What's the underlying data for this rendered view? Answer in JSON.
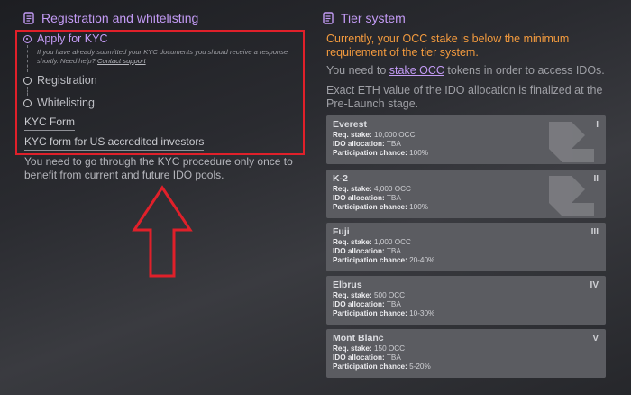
{
  "left_panel": {
    "title": "Registration and whitelisting",
    "steps": [
      {
        "label": "Apply for KYC",
        "active": true
      },
      {
        "label": "Registration",
        "active": false
      },
      {
        "label": "Whitelisting",
        "active": false
      }
    ],
    "kyc_note_text": "If you have already submitted your KYC documents you should receive a response shortly. Need help?",
    "contact_support": "Contact support",
    "kyc_form_link": "KYC Form",
    "kyc_us_link": "KYC form for US accredited investors",
    "kyc_info": "You need to go through the KYC procedure only once to benefit from current and future IDO pools."
  },
  "right_panel": {
    "title": "Tier system",
    "warning": "Currently, your OCC stake is below the minimum requirement of the tier system.",
    "need_prefix": "You need to",
    "stake_link": "stake OCC",
    "need_suffix": "tokens in order to access IDOs.",
    "exact_value": "Exact ETH value of the IDO allocation is finalized at the Pre-Launch stage.",
    "labels": {
      "req_stake": "Req. stake:",
      "ido_allocation": "IDO allocation:",
      "participation": "Participation chance:"
    },
    "tiers": [
      {
        "name": "Everest",
        "numeral": "I",
        "req_stake": "10,000 OCC",
        "ido_allocation": "TBA",
        "participation": "100%"
      },
      {
        "name": "K-2",
        "numeral": "II",
        "req_stake": "4,000 OCC",
        "ido_allocation": "TBA",
        "participation": "100%"
      },
      {
        "name": "Fuji",
        "numeral": "III",
        "req_stake": "1,000 OCC",
        "ido_allocation": "TBA",
        "participation": "20-40%"
      },
      {
        "name": "Elbrus",
        "numeral": "IV",
        "req_stake": "500 OCC",
        "ido_allocation": "TBA",
        "participation": "10-30%"
      },
      {
        "name": "Mont Blanc",
        "numeral": "V",
        "req_stake": "150 OCC",
        "ido_allocation": "TBA",
        "participation": "5-20%"
      }
    ]
  },
  "colors": {
    "accent_purple": "#c39bf5",
    "warning_orange": "#f29a3e",
    "highlight_red": "#e0202a",
    "card_bg": "#5b5c61"
  },
  "icons": [
    "document-icon",
    "up-arrow-annotation",
    "tier-logo-icon"
  ]
}
